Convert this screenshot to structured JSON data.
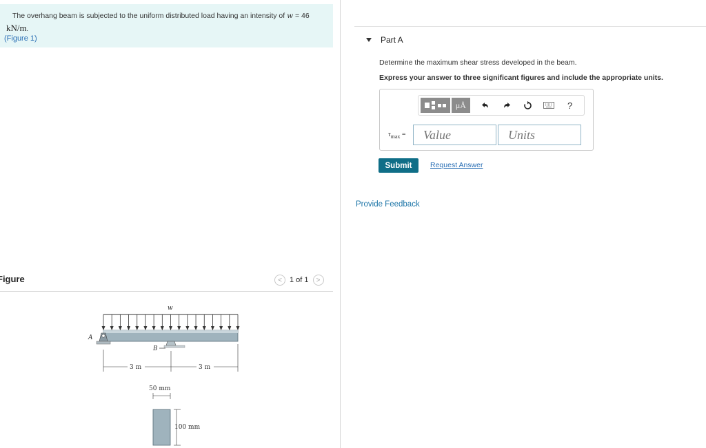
{
  "problem": {
    "text": "The overhang beam is subjected to the uniform distributed load having an intensity of ",
    "var": "w",
    "eq": " = 46",
    "unit": "kN/m",
    "unit_suffix": ".",
    "figure_link": "(Figure 1)"
  },
  "figure": {
    "title": "Figure",
    "pager": "1 of 1",
    "prev_icon": "<",
    "next_icon": ">",
    "labels": {
      "w": "w",
      "a": "A",
      "b": "B",
      "span1": "3 m",
      "span2": "3 m",
      "width": "50 mm",
      "height": "100 mm"
    }
  },
  "part": {
    "title": "Part A",
    "question": "Determine the maximum shear stress developed in the beam.",
    "instruction": "Express your answer to three significant figures and include the appropriate units.",
    "toolbar": {
      "mu_label": "μÅ",
      "help_label": "?"
    },
    "var_sym": "τ",
    "var_sub": "max",
    "var_eq": " =",
    "value_placeholder": "Value",
    "units_placeholder": "Units",
    "submit_label": "Submit",
    "request_label": "Request Answer"
  },
  "feedback_label": "Provide Feedback",
  "colors": {
    "accent": "#0f6e87",
    "link": "#2a6fb5",
    "problem_bg": "#e6f6f6",
    "beam": "#9fb3bd"
  }
}
